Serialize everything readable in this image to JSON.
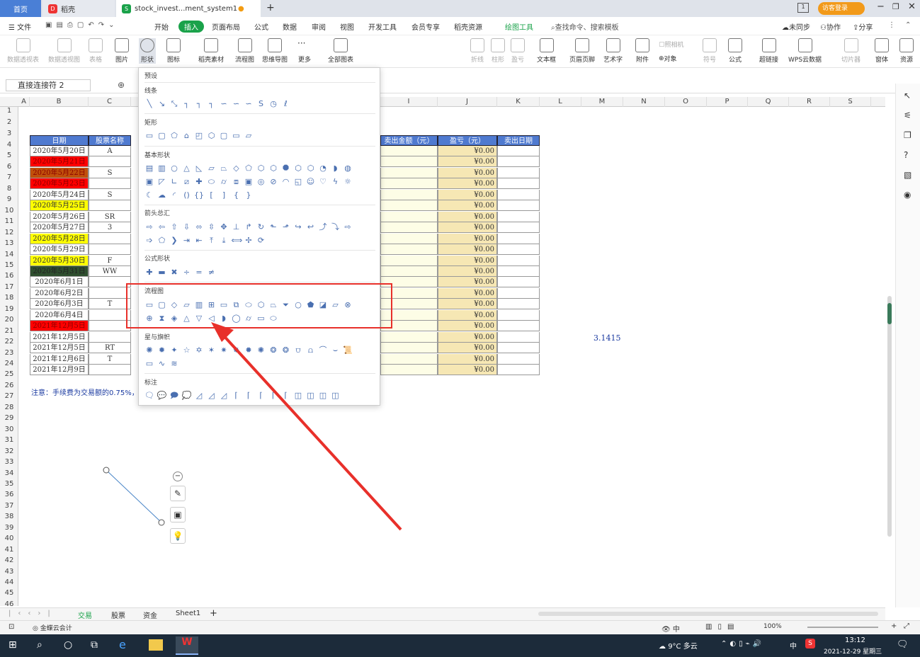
{
  "tabs": {
    "home": "首页",
    "daoke": "稻壳",
    "doc": "stock_invest...ment_system1"
  },
  "topright": {
    "login": "访客登录"
  },
  "menus": {
    "file": "文件",
    "start": "开始",
    "insert": "插入",
    "layout": "页面布局",
    "formula": "公式",
    "data": "数据",
    "review": "审阅",
    "view": "视图",
    "dev": "开发工具",
    "member": "会员专享",
    "resource": "稻壳资源",
    "draw": "绘图工具",
    "search": "查找命令、搜索模板",
    "unsync": "未同步",
    "collab": "协作",
    "share": "分享"
  },
  "ribbon": {
    "pivot": "数据透视表",
    "pivotview": "数据透视图",
    "table": "表格",
    "picture": "图片",
    "shape": "形状",
    "icon": "图标",
    "material": "稻壳素材",
    "flow": "流程图",
    "mind": "思维导图",
    "more": "更多",
    "allchart": "全部图表",
    "line": "折线",
    "column": "柱形",
    "winloss": "盈亏",
    "textbox": "文本框",
    "headerfooter": "页眉页脚",
    "wordart": "艺术字",
    "attach": "附件",
    "camera": "照相机",
    "object": "对象",
    "symbol": "符号",
    "formula2": "公式",
    "hyperlink": "超链接",
    "cloud": "WPS云数据",
    "slicer": "切片器",
    "window": "窗体",
    "resource2": "资源"
  },
  "namebox": "直接连接符 2",
  "cols": [
    "A",
    "B",
    "C",
    "I",
    "J",
    "K",
    "L",
    "M",
    "N",
    "O",
    "P",
    "Q",
    "R",
    "S"
  ],
  "rows": [
    "1",
    "2",
    "3",
    "4",
    "5",
    "6",
    "7",
    "8",
    "9",
    "10",
    "11",
    "12",
    "13",
    "14",
    "15",
    "16",
    "17",
    "18",
    "19",
    "20",
    "21",
    "22",
    "23",
    "24",
    "25",
    "26",
    "27",
    "28",
    "29",
    "30",
    "31",
    "32",
    "33",
    "34",
    "35",
    "36",
    "37",
    "38",
    "39",
    "40",
    "41",
    "42",
    "43",
    "44",
    "45",
    "46"
  ],
  "table": {
    "headers": {
      "date": "日期",
      "name": "股票名称",
      "sell_amt": "卖出金额（元）",
      "pnl": "盈亏（元）",
      "sell_date": "卖出日期"
    },
    "rows": [
      {
        "date": "2020年5月20日",
        "name": "A",
        "pnl": "¥0.00",
        "bg": "#ffffff"
      },
      {
        "date": "2020年5月21日",
        "name": "",
        "pnl": "¥0.00",
        "bg": "#ff0000"
      },
      {
        "date": "2020年5月22日",
        "name": "S",
        "pnl": "¥0.00",
        "bg": "#c0500a"
      },
      {
        "date": "2020年5月23日",
        "name": "",
        "pnl": "¥0.00",
        "bg": "#ff0000"
      },
      {
        "date": "2020年5月24日",
        "name": "S",
        "pnl": "¥0.00",
        "bg": "#ffffff"
      },
      {
        "date": "2020年5月25日",
        "name": "",
        "pnl": "¥0.00",
        "bg": "#ffff00"
      },
      {
        "date": "2020年5月26日",
        "name": "SR",
        "pnl": "¥0.00",
        "bg": "#ffffff"
      },
      {
        "date": "2020年5月27日",
        "name": "3",
        "pnl": "¥0.00",
        "bg": "#ffffff"
      },
      {
        "date": "2020年5月28日",
        "name": "",
        "pnl": "¥0.00",
        "bg": "#ffff00"
      },
      {
        "date": "2020年5月29日",
        "name": "",
        "pnl": "¥0.00",
        "bg": "#ffffff"
      },
      {
        "date": "2020年5月30日",
        "name": "F",
        "pnl": "¥0.00",
        "bg": "#ffff00"
      },
      {
        "date": "2020年5月31日",
        "name": "WW",
        "pnl": "¥0.00",
        "bg": "#2f4f2f"
      },
      {
        "date": "2020年6月1日",
        "name": "",
        "pnl": "¥0.00",
        "bg": "#ffffff"
      },
      {
        "date": "2020年6月2日",
        "name": "",
        "pnl": "¥0.00",
        "bg": "#ffffff"
      },
      {
        "date": "2020年6月3日",
        "name": "T",
        "pnl": "¥0.00",
        "bg": "#ffffff"
      },
      {
        "date": "2020年6月4日",
        "name": "",
        "pnl": "¥0.00",
        "bg": "#ffffff"
      },
      {
        "date": "2021年12月5日",
        "name": "",
        "pnl": "¥0.00",
        "bg": "#ff0000"
      },
      {
        "date": "2021年12月5日",
        "name": "",
        "pnl": "¥0.00",
        "bg": "#ffffff"
      },
      {
        "date": "2021年12月5日",
        "name": "RT",
        "pnl": "¥0.00",
        "bg": "#ffffff"
      },
      {
        "date": "2021年12月6日",
        "name": "T",
        "pnl": "¥0.00",
        "bg": "#ffffff"
      },
      {
        "date": "2021年12月9日",
        "name": "",
        "pnl": "¥0.00",
        "bg": "#ffffff"
      }
    ]
  },
  "note": "注意：手续费为交易额的0.75%，",
  "pi": "3.1415",
  "panel": {
    "preset": "预设",
    "lines": "线条",
    "rect": "矩形",
    "basic": "基本形状",
    "arrows": "箭头总汇",
    "eq": "公式形状",
    "flow": "流程图",
    "stars": "星与旗帜",
    "callout": "标注"
  },
  "sheets": {
    "s1": "交易",
    "s2": "股票",
    "s3": "资金",
    "s4": "Sheet1"
  },
  "status": {
    "brand": "金蝶云会计",
    "zoom": "100%"
  },
  "taskbar": {
    "weather": "9°C 多云",
    "time": "13:12",
    "date": "2021-12-29 星期三",
    "ime": "中"
  },
  "colors": {
    "accent": "#1aa24a",
    "header": "#4f7ad0",
    "arrow": "#e8302a"
  }
}
